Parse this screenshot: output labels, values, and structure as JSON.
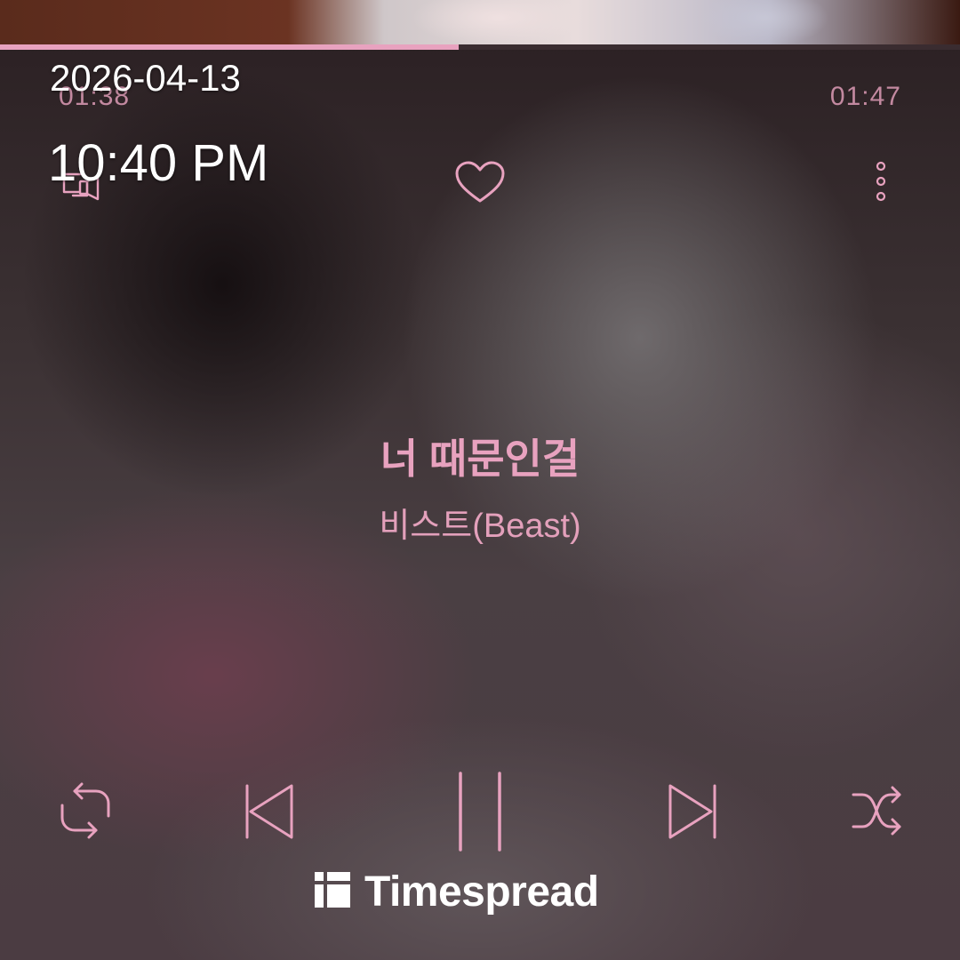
{
  "overlay": {
    "date": "2026-04-13",
    "time": "10:40 PM"
  },
  "player": {
    "elapsed": "01:38",
    "total": "01:47",
    "progress_fraction": 0.478,
    "song_title": "너 때문인걸",
    "artist": "비스트(Beast)",
    "is_playing": true
  },
  "icons": {
    "cast": "cast-icon",
    "favorite": "heart-icon",
    "more": "more-vertical-icon",
    "repeat": "repeat-icon",
    "previous": "skip-previous-icon",
    "pause": "pause-icon",
    "next": "skip-next-icon",
    "shuffle": "shuffle-icon"
  },
  "watermark": {
    "text": "Timespread"
  },
  "colors": {
    "accent": "#e8a2bf",
    "progress_track": "#3c2e32",
    "overlay_text": "#ffffff"
  }
}
